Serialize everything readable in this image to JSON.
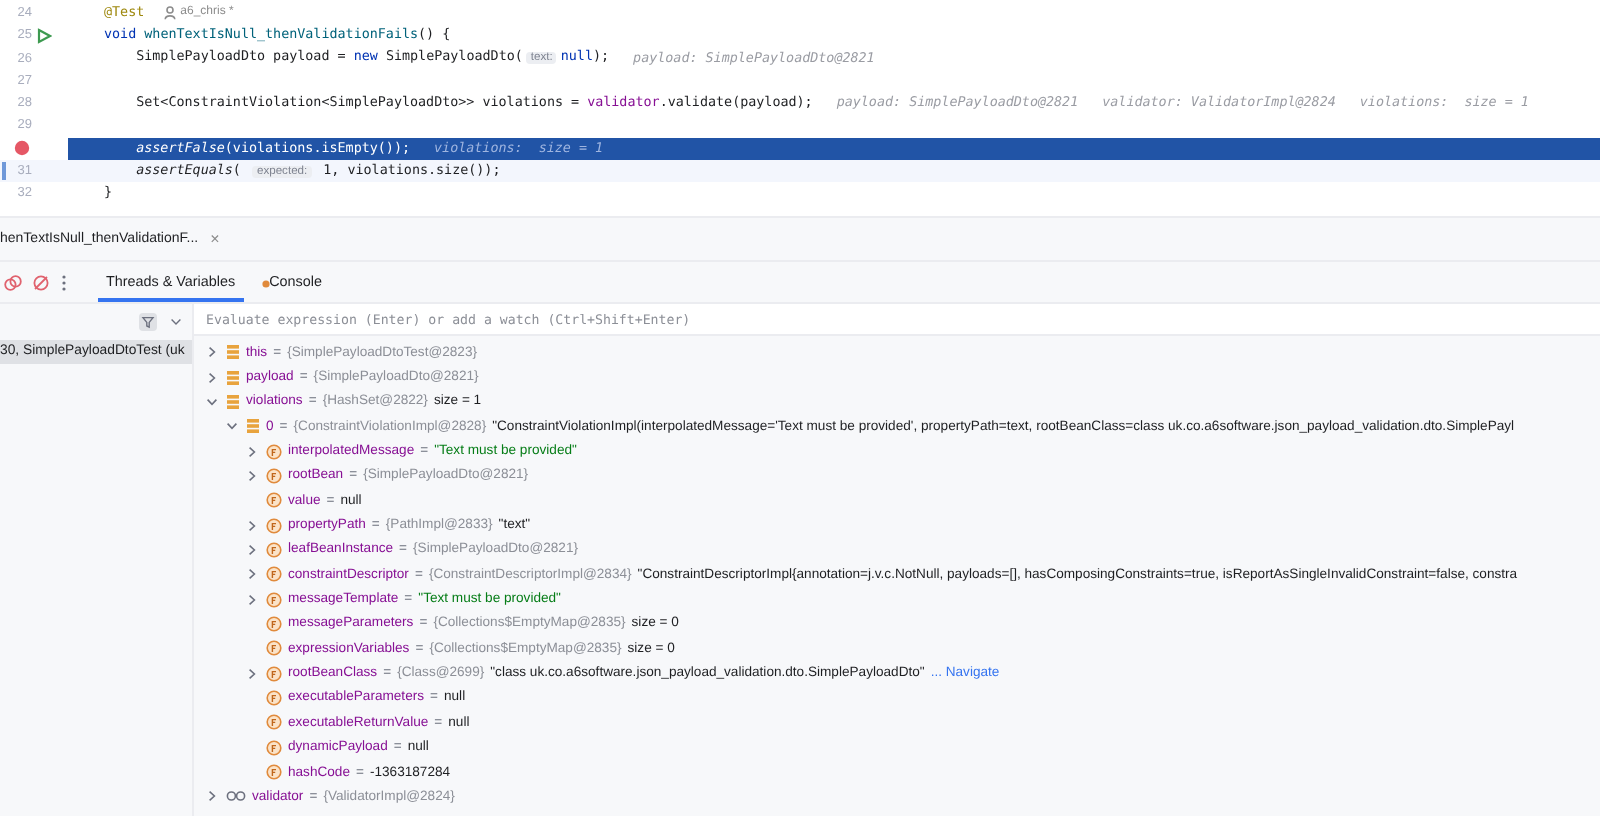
{
  "editor": {
    "lines": [
      {
        "number": "24",
        "kind": "plain",
        "selected": false,
        "caret": false,
        "segments": [
          {
            "kind": "annotation",
            "text": "@Test"
          },
          {
            "kind": "author",
            "text": "a6_chris *"
          }
        ]
      },
      {
        "number": "25",
        "kind": "run",
        "selected": false,
        "caret": false,
        "segments": [
          {
            "kind": "keyword",
            "text": "void"
          },
          {
            "kind": "method",
            "text": " whenTextIsNull_thenValidationFails"
          },
          {
            "kind": "plain",
            "text": "() {"
          }
        ]
      },
      {
        "number": "26",
        "kind": "plain",
        "selected": false,
        "caret": false,
        "segments": [
          {
            "kind": "plain",
            "text": "    SimplePayloadDto payload = "
          },
          {
            "kind": "keyword",
            "text": "new"
          },
          {
            "kind": "plain",
            "text": " SimplePayloadDto("
          },
          {
            "kind": "param",
            "text": "text:"
          },
          {
            "kind": "keyword",
            "text": "null"
          },
          {
            "kind": "plain",
            "text": ");"
          },
          {
            "kind": "hint",
            "text": "payload: SimplePayloadDto@2821"
          }
        ]
      },
      {
        "number": "27",
        "kind": "plain",
        "selected": false,
        "caret": false
      },
      {
        "number": "28",
        "kind": "plain",
        "selected": false,
        "caret": false,
        "segments": [
          {
            "kind": "plain",
            "text": "    Set<ConstraintViolation<SimplePayloadDto>> violations = "
          },
          {
            "kind": "field",
            "text": "validator"
          },
          {
            "kind": "plain",
            "text": ".validate(payload);"
          },
          {
            "kind": "hint",
            "text": "payload: SimplePayloadDto@2821"
          },
          {
            "kind": "hint",
            "text": "validator: ValidatorImpl@2824"
          },
          {
            "kind": "hint",
            "text": "violations:  size = 1"
          }
        ]
      },
      {
        "number": "29",
        "kind": "plain",
        "selected": false,
        "caret": false
      },
      {
        "kind": "breakpoint",
        "selected": true,
        "caret": false,
        "segments": [
          {
            "kind": "static",
            "text": "    assertFalse"
          },
          {
            "kind": "plain",
            "text": "(violations.isEmpty());"
          },
          {
            "kind": "hint",
            "text": "violations:  size = 1"
          }
        ]
      },
      {
        "number": "31",
        "kind": "changed",
        "selected": false,
        "caret": true,
        "segments": [
          {
            "kind": "static",
            "text": "    assertEquals"
          },
          {
            "kind": "plain",
            "text": "( "
          },
          {
            "kind": "param",
            "text": "expected:"
          },
          {
            "kind": "plain",
            "text": " 1, violations.size());"
          }
        ]
      },
      {
        "number": "32",
        "kind": "plain",
        "selected": false,
        "caret": false,
        "segments": [
          {
            "kind": "plain",
            "text": "}"
          }
        ]
      }
    ]
  },
  "session_tab": {
    "label": "henTextIsNull_thenValidationF...",
    "close": "×"
  },
  "debug_tabs": [
    {
      "label": "Threads & Variables",
      "selected": true
    },
    {
      "label": "Console",
      "selected": false
    }
  ],
  "frames": [
    {
      "label": "30, SimplePayloadDtoTest (uk",
      "selected": true
    }
  ],
  "evaluate": {
    "placeholder": "Evaluate expression (Enter) or add a watch (Ctrl+Shift+Enter)"
  },
  "variables": [
    {
      "name": "this",
      "kind": "local",
      "sign": "=",
      "expanded": false,
      "values": [
        {
          "kind": "type",
          "text": "{SimplePayloadDtoTest@2823}"
        }
      ]
    },
    {
      "name": "payload",
      "kind": "local",
      "sign": "=",
      "expanded": false,
      "values": [
        {
          "kind": "type",
          "text": "{SimplePayloadDto@2821}"
        }
      ]
    },
    {
      "name": "violations",
      "kind": "local",
      "sign": "=",
      "expanded": true,
      "values": [
        {
          "kind": "type",
          "text": "{HashSet@2822}"
        },
        {
          "kind": "text",
          "text": "size = 1"
        }
      ],
      "children": [
        {
          "name": "0",
          "kind": "local",
          "sign": "=",
          "expanded": true,
          "values": [
            {
              "kind": "type",
              "text": "{ConstraintViolationImpl@2828}"
            },
            {
              "kind": "text",
              "text": "\"ConstraintViolationImpl(interpolatedMessage='Text must be provided', propertyPath=text, rootBeanClass=class uk.co.a6software.json_payload_validation.dto.SimplePayl"
            }
          ],
          "children": [
            {
              "name": "interpolatedMessage",
              "kind": "field",
              "sign": "=",
              "expanded": false,
              "values": [
                {
                  "kind": "string",
                  "text": "\"Text must be provided\""
                }
              ]
            },
            {
              "name": "rootBean",
              "kind": "field",
              "sign": "=",
              "expanded": false,
              "values": [
                {
                  "kind": "type",
                  "text": "{SimplePayloadDto@2821}"
                }
              ]
            },
            {
              "name": "value",
              "kind": "field",
              "sign": "=",
              "values": [
                {
                  "kind": "text",
                  "text": "null"
                }
              ]
            },
            {
              "name": "propertyPath",
              "kind": "field",
              "sign": "=",
              "expanded": false,
              "values": [
                {
                  "kind": "type",
                  "text": "{PathImpl@2833}"
                },
                {
                  "kind": "text",
                  "text": "\"text\""
                }
              ]
            },
            {
              "name": "leafBeanInstance",
              "kind": "field",
              "sign": "=",
              "expanded": false,
              "values": [
                {
                  "kind": "type",
                  "text": "{SimplePayloadDto@2821}"
                }
              ]
            },
            {
              "name": "constraintDescriptor",
              "kind": "field",
              "sign": "=",
              "expanded": false,
              "values": [
                {
                  "kind": "type",
                  "text": "{ConstraintDescriptorImpl@2834}"
                },
                {
                  "kind": "text",
                  "text": "\"ConstraintDescriptorImpl{annotation=j.v.c.NotNull, payloads=[], hasComposingConstraints=true, isReportAsSingleInvalidConstraint=false, constra"
                }
              ]
            },
            {
              "name": "messageTemplate",
              "kind": "field",
              "sign": "=",
              "expanded": false,
              "values": [
                {
                  "kind": "string",
                  "text": "\"Text must be provided\""
                }
              ]
            },
            {
              "name": "messageParameters",
              "kind": "field",
              "sign": "=",
              "values": [
                {
                  "kind": "type",
                  "text": "{Collections$EmptyMap@2835}"
                },
                {
                  "kind": "text",
                  "text": "size = 0"
                }
              ]
            },
            {
              "name": "expressionVariables",
              "kind": "field",
              "sign": "=",
              "values": [
                {
                  "kind": "type",
                  "text": "{Collections$EmptyMap@2835}"
                },
                {
                  "kind": "text",
                  "text": "size = 0"
                }
              ]
            },
            {
              "name": "rootBeanClass",
              "kind": "field",
              "sign": "=",
              "expanded": false,
              "values": [
                {
                  "kind": "type",
                  "text": "{Class@2699}"
                },
                {
                  "kind": "text",
                  "text": "\"class uk.co.a6software.json_payload_validation.dto.SimplePayloadDto\""
                },
                {
                  "kind": "link",
                  "text": "... Navigate"
                }
              ]
            },
            {
              "name": "executableParameters",
              "kind": "field",
              "sign": "=",
              "values": [
                {
                  "kind": "text",
                  "text": "null"
                }
              ]
            },
            {
              "name": "executableReturnValue",
              "kind": "field",
              "sign": "=",
              "values": [
                {
                  "kind": "text",
                  "text": "null"
                }
              ]
            },
            {
              "name": "dynamicPayload",
              "kind": "field",
              "sign": "=",
              "values": [
                {
                  "kind": "text",
                  "text": "null"
                }
              ]
            },
            {
              "name": "hashCode",
              "kind": "field",
              "sign": "=",
              "values": [
                {
                  "kind": "text",
                  "text": "-1363187284"
                }
              ]
            }
          ]
        }
      ]
    },
    {
      "name": "validator",
      "kind": "watch",
      "sign": "=",
      "expanded": false,
      "values": [
        {
          "kind": "type",
          "text": "{ValidatorImpl@2824}"
        }
      ]
    }
  ]
}
